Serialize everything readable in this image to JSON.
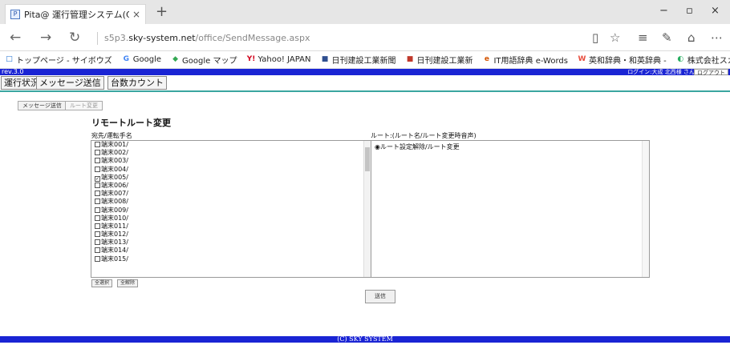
{
  "browser": {
    "tab_title": "Pita@ 運行管理システム(C",
    "tab_close": "×",
    "new_tab": "+",
    "url_prefix": "s5p3.",
    "url_domain": "sky-system.net",
    "url_path": "/office/SendMessage.aspx",
    "nav": {
      "back": "←",
      "forward": "→",
      "refresh": "↻"
    },
    "toolbar_icons": [
      "reading-view-icon",
      "favorite-star-icon",
      "hub-icon",
      "notes-icon",
      "share-icon",
      "more-icon"
    ],
    "window_controls": {
      "minimize": "−",
      "maximize": "▫",
      "close": "×"
    }
  },
  "favorites": [
    {
      "label": "トップページ - サイボウズ",
      "icon": "cybozu-icon",
      "color": "#1e6fd0",
      "glyph": "□"
    },
    {
      "label": "Google",
      "icon": "google-icon",
      "color": "#4285f4",
      "glyph": "G"
    },
    {
      "label": "Google マップ",
      "icon": "google-maps-icon",
      "color": "#34a853",
      "glyph": "◆"
    },
    {
      "label": "Yahoo! JAPAN",
      "icon": "yahoo-icon",
      "color": "#d0021b",
      "glyph": "Y!"
    },
    {
      "label": "日刊建設工業新聞",
      "icon": "newspaper-icon",
      "color": "#2f4f8f",
      "glyph": "■"
    },
    {
      "label": "日刊建設工業新",
      "icon": "newspaper-icon-2",
      "color": "#c0392b",
      "glyph": "■"
    },
    {
      "label": "IT用語辞典 e-Words",
      "icon": "ie-icon",
      "color": "#d35400",
      "glyph": "e"
    },
    {
      "label": "英和辞典・和英辞典 -",
      "icon": "weblio-icon",
      "color": "#e74c3c",
      "glyph": "W"
    },
    {
      "label": "株式会社スカイシス",
      "icon": "sky-icon",
      "color": "#27ae60",
      "glyph": "◐"
    }
  ],
  "app": {
    "rev": "rev.3.0",
    "login_info": "ログイン:大成 北西様 さん",
    "logout": "ログアウト",
    "menu": [
      "運行状況",
      "メッセージ送信",
      "台数カウント"
    ],
    "subtabs": [
      "メッセージ送信",
      "ルート変更"
    ],
    "heading": "リモートルート変更",
    "left_label": "宛先/運転手名",
    "right_label": "ルート:(ルート名/ルート変更時音声)",
    "terminals": [
      {
        "label": "端末001/",
        "checked": false
      },
      {
        "label": "端末002/",
        "checked": false
      },
      {
        "label": "端末003/",
        "checked": false
      },
      {
        "label": "端末004/",
        "checked": false
      },
      {
        "label": "端末005/",
        "checked": true
      },
      {
        "label": "端末006/",
        "checked": false
      },
      {
        "label": "端末007/",
        "checked": false
      },
      {
        "label": "端末008/",
        "checked": false
      },
      {
        "label": "端末009/",
        "checked": false
      },
      {
        "label": "端末010/",
        "checked": false
      },
      {
        "label": "端末011/",
        "checked": false
      },
      {
        "label": "端末012/",
        "checked": false
      },
      {
        "label": "端末013/",
        "checked": false
      },
      {
        "label": "端末014/",
        "checked": false
      },
      {
        "label": "端末015/",
        "checked": false
      }
    ],
    "route_option": "ルート設定解除/ルート変更",
    "select_all": "全選択",
    "deselect_all": "全解除",
    "send": "送信",
    "footer": "(C) SKY SYSTEM",
    "colors": {
      "header_blue": "#1a24d4",
      "accent_teal": "#3aa6a0"
    }
  }
}
